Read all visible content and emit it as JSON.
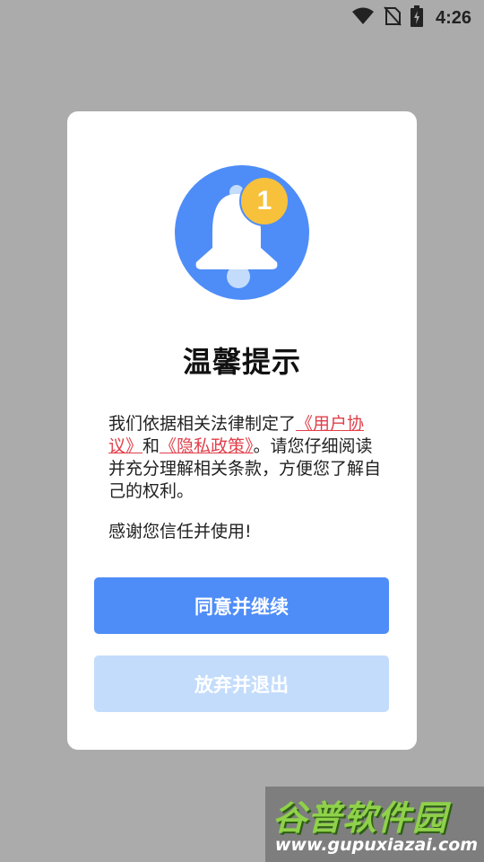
{
  "status_bar": {
    "time": "4:26"
  },
  "dialog": {
    "badge_count": "1",
    "title": "温馨提示",
    "body_prefix": "我们依据相关法律制定了",
    "user_agreement_link": "《用户协议》",
    "and_text": "和",
    "privacy_policy_link": "《隐私政策》",
    "body_suffix": "。请您仔细阅读并充分理解相关条款，方便您了解自己的权利。",
    "thanks": "感谢您信任并使用!",
    "agree_button": "同意并继续",
    "exit_button": "放弃并退出"
  },
  "watermark": {
    "title": "谷普软件园",
    "url": "www.gupuxiazai.com"
  },
  "colors": {
    "primary": "#4e8df8",
    "primary_light": "#c3dcfc",
    "link": "#e0404b",
    "badge": "#f7c13b",
    "overlay": "#ababab"
  }
}
